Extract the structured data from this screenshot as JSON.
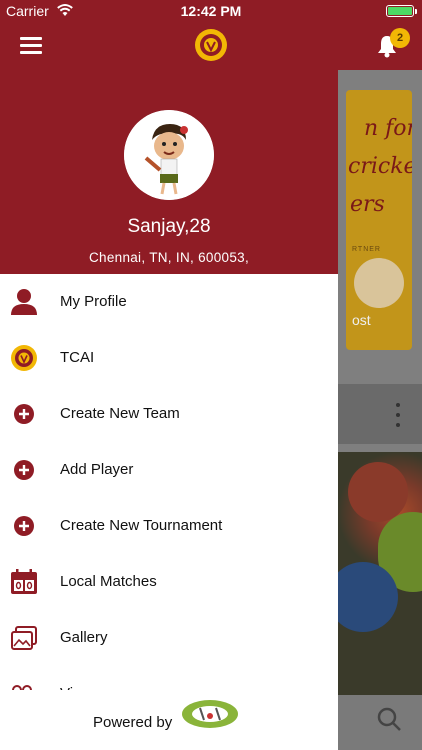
{
  "status_bar": {
    "carrier": "Carrier",
    "time": "12:42 PM",
    "battery_level": 1.0
  },
  "header": {
    "notification_count": "2",
    "logo_icon": "tcai-emblem-icon",
    "menu_icon": "hamburger-menu-icon",
    "bell_icon": "bell-icon"
  },
  "profile": {
    "name": "Sanjay,28",
    "address": "Chennai, TN, IN, 600053,"
  },
  "menu": {
    "items": [
      {
        "label": "My Profile",
        "icon": "user-icon"
      },
      {
        "label": "TCAI",
        "icon": "tcai-emblem-icon"
      },
      {
        "label": "Create New Team",
        "icon": "plus-circle-icon"
      },
      {
        "label": "Add Player",
        "icon": "plus-circle-icon"
      },
      {
        "label": "Create New Tournament",
        "icon": "plus-circle-icon"
      },
      {
        "label": "Local Matches",
        "icon": "scoreboard-calendar-icon"
      },
      {
        "label": "Gallery",
        "icon": "gallery-icon"
      },
      {
        "label": "Vi",
        "icon": "video-icon"
      }
    ]
  },
  "footer": {
    "powered_by": "Powered by",
    "brand": "CricDost"
  },
  "background": {
    "card_lines": [
      "n for",
      "cricket",
      "ers"
    ],
    "card_small": "RTNER",
    "card_brand": "ost"
  },
  "colors": {
    "primary": "#8f1c25",
    "badge": "#f2b705",
    "card": "#c2951a"
  }
}
